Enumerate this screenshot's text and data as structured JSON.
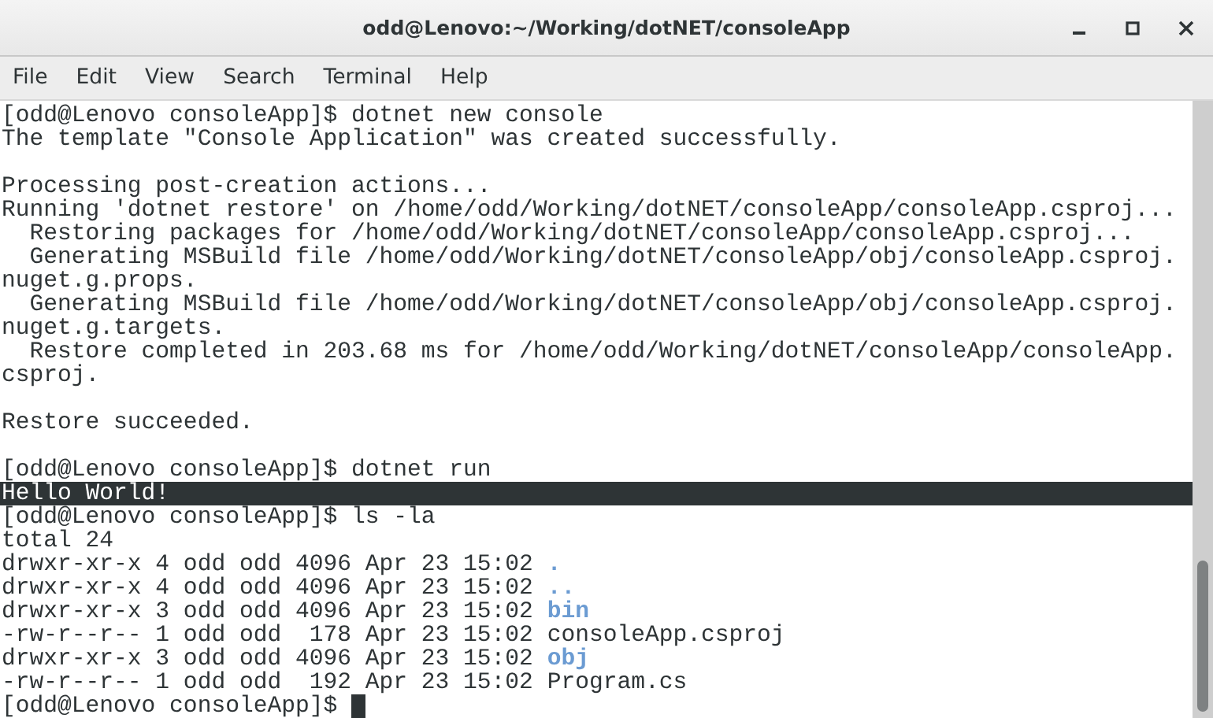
{
  "window": {
    "title": "odd@Lenovo:~/Working/dotNET/consoleApp"
  },
  "menu": [
    {
      "label": "File"
    },
    {
      "label": "Edit"
    },
    {
      "label": "View"
    },
    {
      "label": "Search"
    },
    {
      "label": "Terminal"
    },
    {
      "label": "Help"
    }
  ],
  "terminal": {
    "lines": [
      {
        "highlighted": false,
        "segments": [
          {
            "kind": "plain",
            "text": "[odd@Lenovo consoleApp]$ dotnet new console"
          }
        ]
      },
      {
        "highlighted": false,
        "segments": [
          {
            "kind": "plain",
            "text": "The template \"Console Application\" was created successfully."
          }
        ]
      },
      {
        "highlighted": false
      },
      {
        "highlighted": false,
        "segments": [
          {
            "kind": "plain",
            "text": "Processing post-creation actions..."
          }
        ]
      },
      {
        "highlighted": false,
        "segments": [
          {
            "kind": "plain",
            "text": "Running 'dotnet restore' on /home/odd/Working/dotNET/consoleApp/consoleApp.csproj..."
          }
        ]
      },
      {
        "highlighted": false,
        "segments": [
          {
            "kind": "plain",
            "text": "  Restoring packages for /home/odd/Working/dotNET/consoleApp/consoleApp.csproj..."
          }
        ]
      },
      {
        "highlighted": false,
        "segments": [
          {
            "kind": "plain",
            "text": "  Generating MSBuild file /home/odd/Working/dotNET/consoleApp/obj/consoleApp.csproj."
          }
        ]
      },
      {
        "highlighted": false,
        "segments": [
          {
            "kind": "plain",
            "text": "nuget.g.props."
          }
        ]
      },
      {
        "highlighted": false,
        "segments": [
          {
            "kind": "plain",
            "text": "  Generating MSBuild file /home/odd/Working/dotNET/consoleApp/obj/consoleApp.csproj."
          }
        ]
      },
      {
        "highlighted": false,
        "segments": [
          {
            "kind": "plain",
            "text": "nuget.g.targets."
          }
        ]
      },
      {
        "highlighted": false,
        "segments": [
          {
            "kind": "plain",
            "text": "  Restore completed in 203.68 ms for /home/odd/Working/dotNET/consoleApp/consoleApp."
          }
        ]
      },
      {
        "highlighted": false,
        "segments": [
          {
            "kind": "plain",
            "text": "csproj."
          }
        ]
      },
      {
        "highlighted": false
      },
      {
        "highlighted": false,
        "segments": [
          {
            "kind": "plain",
            "text": "Restore succeeded."
          }
        ]
      },
      {
        "highlighted": false
      },
      {
        "highlighted": false,
        "segments": [
          {
            "kind": "plain",
            "text": "[odd@Lenovo consoleApp]$ dotnet run"
          }
        ]
      },
      {
        "highlighted": true,
        "segments": [
          {
            "kind": "plain",
            "text": "Hello World!"
          }
        ]
      },
      {
        "highlighted": false,
        "segments": [
          {
            "kind": "plain",
            "text": "[odd@Lenovo consoleApp]$ ls -la"
          }
        ]
      },
      {
        "highlighted": false,
        "segments": [
          {
            "kind": "plain",
            "text": "total 24"
          }
        ]
      },
      {
        "highlighted": false,
        "segments": [
          {
            "kind": "plain",
            "text": "drwxr-xr-x 4 odd odd 4096 Apr 23 15:02"
          },
          {
            "kind": "directory",
            "text": "."
          }
        ]
      },
      {
        "highlighted": false,
        "segments": [
          {
            "kind": "plain",
            "text": "drwxr-xr-x 4 odd odd 4096 Apr 23 15:02"
          },
          {
            "kind": "directory",
            "text": ".."
          }
        ]
      },
      {
        "highlighted": false,
        "segments": [
          {
            "kind": "plain",
            "text": "drwxr-xr-x 3 odd odd 4096 Apr 23 15:02"
          },
          {
            "kind": "directory",
            "text": "bin"
          }
        ]
      },
      {
        "highlighted": false,
        "segments": [
          {
            "kind": "plain",
            "text": "-rw-r--r-- 1 odd odd  178 Apr 23 15:02"
          },
          {
            "kind": "plain",
            "text": "consoleApp.csproj"
          }
        ]
      },
      {
        "highlighted": false,
        "segments": [
          {
            "kind": "plain",
            "text": "drwxr-xr-x 3 odd odd 4096 Apr 23 15:02"
          },
          {
            "kind": "directory",
            "text": "obj"
          }
        ]
      },
      {
        "highlighted": false,
        "segments": [
          {
            "kind": "plain",
            "text": "-rw-r--r-- 1 odd odd  192 Apr 23 15:02"
          },
          {
            "kind": "plain",
            "text": "Program.cs"
          }
        ]
      },
      {
        "highlighted": false,
        "segments": [
          {
            "kind": "plain",
            "text": "[odd@Lenovo consoleApp]$"
          }
        ],
        "cursor": true
      }
    ]
  }
}
